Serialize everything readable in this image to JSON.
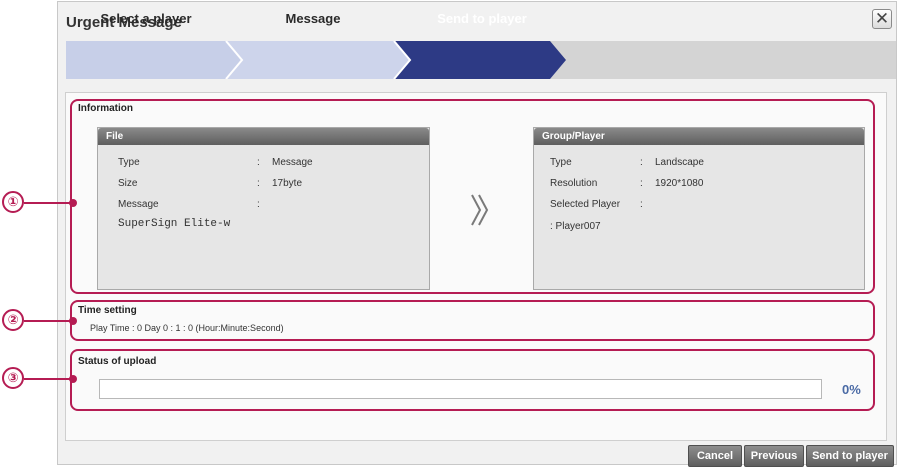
{
  "dialog": {
    "title": "Urgent Message",
    "close_icon": "close-icon"
  },
  "wizard": {
    "steps": [
      {
        "label": "Select a player",
        "state": "done"
      },
      {
        "label": "Message",
        "state": "done"
      },
      {
        "label": "Send to player",
        "state": "active"
      }
    ],
    "colors": {
      "done": "#c8cfe8",
      "active": "#2f3c86"
    }
  },
  "information": {
    "title": "Information",
    "arrow_icon": "double-chevron-right-icon",
    "file": {
      "title": "File",
      "rows": [
        {
          "label": "Type",
          "sep": ":",
          "value": "Message"
        },
        {
          "label": "Size",
          "sep": ":",
          "value": "17byte"
        },
        {
          "label": "Message",
          "sep": ":",
          "value": ""
        }
      ],
      "message_text": "SuperSign Elite-w"
    },
    "group_player": {
      "title": "Group/Player",
      "rows": [
        {
          "label": "Type",
          "sep": ":",
          "value": "Landscape"
        },
        {
          "label": "Resolution",
          "sep": ":",
          "value": "1920*1080"
        },
        {
          "label": "Selected Player",
          "sep": ":",
          "value": ""
        }
      ],
      "player": ":  Player007"
    }
  },
  "time_setting": {
    "title": "Time setting",
    "text": "Play Time  :  0 Day  0 : 1 : 0  (Hour:Minute:Second)"
  },
  "upload": {
    "title": "Status of upload",
    "progress": 0,
    "percent_label": "0%"
  },
  "callouts": [
    "①",
    "②",
    "③"
  ],
  "accent_color": "#b51c53",
  "buttons": {
    "cancel": "Cancel",
    "previous": "Previous",
    "send": "Send to player"
  }
}
